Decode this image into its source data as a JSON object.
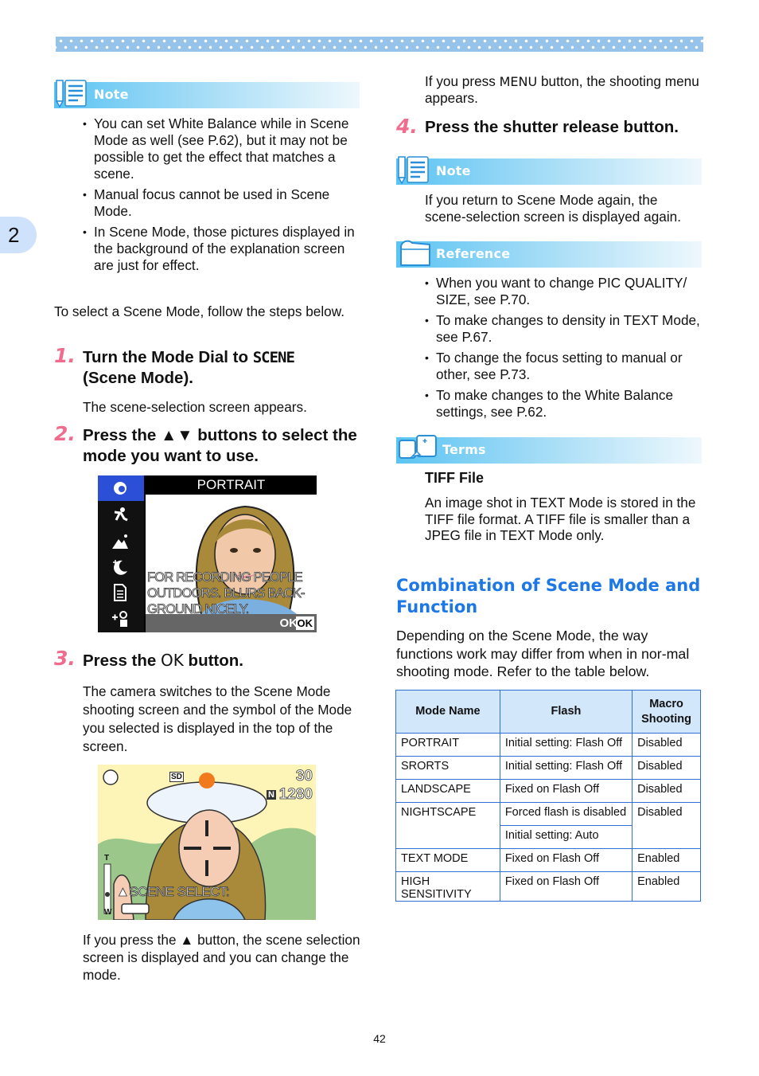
{
  "chapter_tab": "2",
  "page_number": "42",
  "left_note": {
    "label": "Note",
    "items": [
      "You can set White Balance while in Scene Mode as well (see P.62), but it may not be possible to get the effect that matches a scene.",
      "Manual focus cannot be used in Scene Mode.",
      "In Scene Mode, those pictures displayed in the background of the explanation screen are just for effect."
    ]
  },
  "intro": "To select a Scene Mode, follow the steps below.",
  "steps": [
    {
      "num": "1.",
      "title_pre": "Turn the Mode Dial to ",
      "title_symbol": "SCENE",
      "title_post": "(Scene Mode).",
      "body": "The scene-selection screen appears."
    },
    {
      "num": "2.",
      "title_pre": "Press the ",
      "title_symbol": "▲▼",
      "title_post": " buttons to select the mode you want to use."
    },
    {
      "num": "3.",
      "title_pre": "Press the ",
      "title_symbol": "OK",
      "title_post": " button.",
      "body": "The camera switches to the Scene Mode shooting screen and the symbol of the Mode you selected is displayed in the top of the screen.",
      "after_image": "If you press the ▲ button, the scene selection screen is displayed and you can change the mode."
    },
    {
      "num": "4.",
      "title": "Press the shutter release button."
    }
  ],
  "menu_text_pre": "If you press ",
  "menu_text_key": "MENU",
  "menu_text_post": " button, the shooting menu appears.",
  "scene_screen": {
    "title": "PORTRAIT",
    "caption": [
      "FOR RECORDING PEOPLE",
      "OUTDOORS. BLURS BACK-",
      "GROUND NICELY."
    ],
    "ok_label": "OK",
    "ok_key": "OK",
    "menu_icons": [
      "portrait-icon",
      "sports-icon",
      "landscape-icon",
      "nightscape-icon",
      "text-mode-icon",
      "high-sensitivity-icon"
    ]
  },
  "shooting_screen": {
    "shots_remaining": "30",
    "quality": "N",
    "size": "1280",
    "sd_label": "SD",
    "scene_select": "SCENE SELECT:",
    "zoom_top": "T",
    "zoom_bottom": "W"
  },
  "right_note": {
    "label": "Note",
    "text": "If you return to Scene Mode again, the scene-selection screen is displayed again."
  },
  "reference": {
    "label": "Reference",
    "items": [
      "When you want to change PIC QUALITY/ SIZE, see P.70.",
      "To make changes to density in TEXT Mode, see P.67.",
      "To change the focus setting to manual or other, see P.73.",
      "To make changes to the White Balance settings, see P.62."
    ]
  },
  "terms": {
    "label": "Terms",
    "term": "TIFF File",
    "definition": "An image shot in TEXT Mode is stored in the TIFF file format. A TIFF file is smaller than a JPEG file in TEXT Mode only."
  },
  "combination": {
    "heading": "Combination of Scene Mode and Function",
    "body": "Depending on the Scene Mode, the way functions work may differ from when in nor-mal shooting mode. Refer to the table below.",
    "headers": [
      "Mode Name",
      "Flash",
      "Macro Shooting"
    ],
    "rows": [
      {
        "mode": "PORTRAIT",
        "flash": "Initial setting: Flash Off",
        "macro": "Disabled"
      },
      {
        "mode": "SRORTS",
        "flash": "Initial setting: Flash Off",
        "macro": "Disabled"
      },
      {
        "mode": "LANDSCAPE",
        "flash": "Fixed on Flash Off",
        "macro": "Disabled"
      },
      {
        "mode": "NIGHTSCAPE",
        "flash": "Forced flash is disabled",
        "flash2": "Initial setting: Auto",
        "macro": "Disabled"
      },
      {
        "mode": "TEXT MODE",
        "flash": "Fixed on Flash Off",
        "macro": "Enabled"
      },
      {
        "mode": "HIGH SENSITIVITY",
        "flash": "Fixed on Flash Off",
        "macro": "Enabled"
      }
    ]
  }
}
